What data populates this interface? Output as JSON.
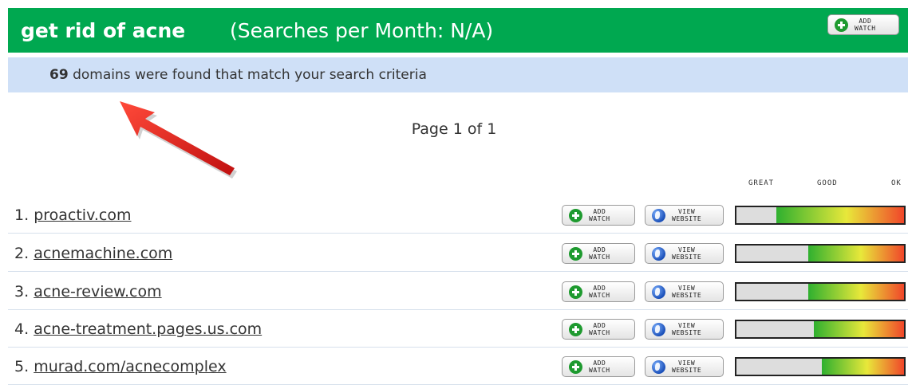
{
  "header": {
    "keyword": "get rid of acne",
    "searches": "(Searches per Month: N/A)",
    "add_watch": [
      "ADD",
      "WATCH"
    ],
    "colors": {
      "header_bg": "#00a850",
      "banner_bg": "#cfe0f7"
    }
  },
  "summary": {
    "count": "69",
    "text": "domains were found that match your search criteria"
  },
  "pagination": {
    "label": "Page 1 of 1"
  },
  "legend": {
    "great": "GREAT",
    "good": "GOOD",
    "ok": "OK"
  },
  "row_buttons": {
    "add": [
      "ADD",
      "WATCH"
    ],
    "view": [
      "VIEW",
      "WEBSITE"
    ]
  },
  "domains": [
    {
      "num": "1.",
      "name": "proactiv.com",
      "score": 0.76
    },
    {
      "num": "2.",
      "name": "acnemachine.com",
      "score": 0.57
    },
    {
      "num": "3.",
      "name": "acne-review.com",
      "score": 0.57
    },
    {
      "num": "4.",
      "name": "acne-treatment.pages.us.com",
      "score": 0.54
    },
    {
      "num": "5.",
      "name": "murad.com/acnecomplex",
      "score": 0.49
    }
  ]
}
